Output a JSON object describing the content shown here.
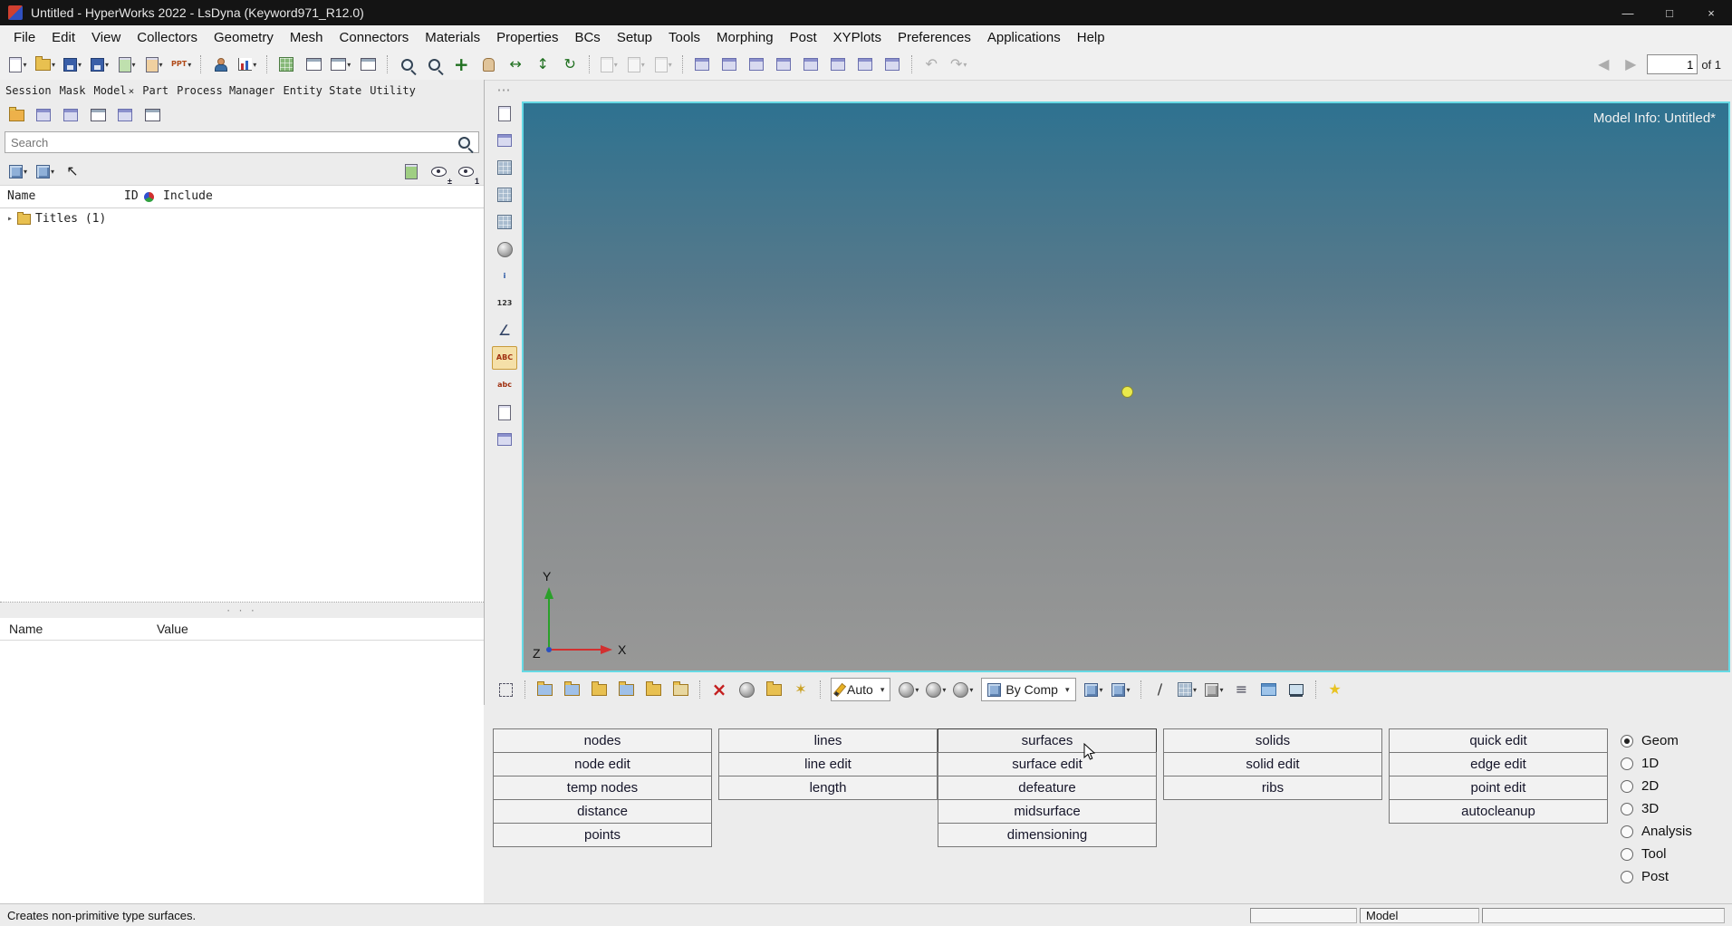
{
  "ui": {
    "close_glyph": "×",
    "dropdown_glyph": "▾"
  },
  "titlebar": {
    "title": "Untitled - HyperWorks 2022 - LsDyna (Keyword971_R12.0)",
    "controls": [
      {
        "name": "minimize-button",
        "glyph": "—"
      },
      {
        "name": "maximize-button",
        "glyph": "□"
      },
      {
        "name": "close-button",
        "glyph": "×"
      }
    ]
  },
  "menubar": {
    "items": [
      "File",
      "Edit",
      "View",
      "Collectors",
      "Geometry",
      "Mesh",
      "Connectors",
      "Materials",
      "Properties",
      "BCs",
      "Setup",
      "Tools",
      "Morphing",
      "Post",
      "XYPlots",
      "Preferences",
      "Applications",
      "Help"
    ]
  },
  "toolbar_top": {
    "icons": [
      {
        "name": "new-session-icon",
        "kind": "doc",
        "dd": true
      },
      {
        "name": "open-file-icon",
        "kind": "folder",
        "dd": true
      },
      {
        "name": "save-file-icon",
        "kind": "disk",
        "dd": true
      },
      {
        "name": "save-as-icon",
        "kind": "disk",
        "dd": true
      },
      {
        "name": "import-icon",
        "kind": "doc",
        "tint": "#bfe0ae",
        "dd": true
      },
      {
        "name": "export-icon",
        "kind": "doc",
        "tint": "#f0d0a0",
        "dd": true
      },
      {
        "name": "publish-ppt-icon",
        "kind": "text",
        "text": "PPT",
        "dd": true
      },
      {
        "kind": "sep"
      },
      {
        "name": "user-profiles-icon",
        "kind": "user"
      },
      {
        "name": "plot-report-icon",
        "kind": "chart",
        "dd": true
      },
      {
        "kind": "sep"
      },
      {
        "name": "screen-capture-grid-icon",
        "kind": "grid"
      },
      {
        "name": "empty-page-icon",
        "kind": "win"
      },
      {
        "name": "page-layout-icon",
        "kind": "win",
        "dd": true
      },
      {
        "name": "split-window-icon",
        "kind": "win"
      },
      {
        "kind": "sep"
      },
      {
        "name": "zoom-icon",
        "kind": "mag"
      },
      {
        "name": "fit-view-icon",
        "kind": "mag"
      },
      {
        "name": "center-view-icon",
        "glyph": "+",
        "color": "#207020",
        "big": true
      },
      {
        "name": "pan-hand-icon",
        "kind": "hand"
      },
      {
        "name": "dynamic-rotate-icon",
        "glyph": "↔",
        "color": "#207020"
      },
      {
        "name": "dynamic-zoom-icon",
        "glyph": "↕",
        "color": "#207020"
      },
      {
        "name": "refresh-view-icon",
        "glyph": "↻",
        "color": "#207020"
      },
      {
        "kind": "sep"
      },
      {
        "name": "cut-icon",
        "kind": "doc",
        "disabled": true,
        "dd": true
      },
      {
        "name": "copy-icon",
        "kind": "doc",
        "disabled": true,
        "dd": true
      },
      {
        "name": "paste-icon",
        "kind": "doc",
        "disabled": true,
        "dd": true
      },
      {
        "kind": "sep"
      },
      {
        "name": "add-page-icon",
        "kind": "winp"
      },
      {
        "name": "delete-page-icon",
        "kind": "winp"
      },
      {
        "name": "next-window-icon",
        "kind": "winp"
      },
      {
        "name": "expand-window-icon",
        "kind": "winp"
      },
      {
        "name": "tile-vertical-icon",
        "kind": "winp"
      },
      {
        "name": "tile-horizontal-icon",
        "kind": "winp"
      },
      {
        "name": "swap-window-icon",
        "kind": "winp"
      },
      {
        "name": "record-window-icon",
        "kind": "winp"
      },
      {
        "kind": "sep"
      },
      {
        "name": "undo-icon",
        "glyph": "↶",
        "disabled": true
      },
      {
        "name": "redo-icon",
        "glyph": "↷",
        "disabled": true,
        "dd": true
      }
    ],
    "nav_icons": [
      {
        "name": "previous-page-icon",
        "glyph": "◀",
        "disabled": true
      },
      {
        "name": "next-page-icon",
        "glyph": "▶",
        "disabled": true
      }
    ],
    "page_value": "1",
    "page_suffix": "of 1"
  },
  "left_panel": {
    "tabs": [
      {
        "label": "Session"
      },
      {
        "label": "Mask"
      },
      {
        "label": "Model",
        "active": true,
        "closable": true
      },
      {
        "label": "Part"
      },
      {
        "label": "Process Manager"
      },
      {
        "label": "Entity State"
      },
      {
        "label": "Utility"
      }
    ],
    "browser_toolbar": [
      {
        "name": "entities-view-icon",
        "kind": "folder",
        "tint": "#edb14a"
      },
      {
        "name": "create-subsystem-icon",
        "kind": "winp"
      },
      {
        "name": "organize-entities-icon",
        "kind": "winp"
      },
      {
        "name": "configure-browser-icon",
        "kind": "win"
      },
      {
        "name": "filter-entities-icon",
        "kind": "winp"
      },
      {
        "name": "refresh-browser-icon",
        "kind": "win"
      }
    ],
    "search_placeholder": "Search",
    "display_left": [
      {
        "name": "show-entities-dropdown-icon",
        "kind": "cube",
        "dd": true
      },
      {
        "name": "display-mode-dropdown-icon",
        "kind": "cube",
        "dd": true
      },
      {
        "name": "selector-arrow-icon",
        "glyph": "↖",
        "color": "#222222"
      }
    ],
    "display_right": [
      {
        "name": "add-to-collector-icon",
        "kind": "doc",
        "tint": "#9fce83"
      },
      {
        "name": "show-hide-toggle-icon",
        "kind": "eye",
        "sub": "±"
      },
      {
        "name": "isolate-one-icon",
        "kind": "eye",
        "sub": "1"
      }
    ],
    "columns": {
      "name": "Name",
      "id": "ID",
      "include": "Include"
    },
    "tree": [
      {
        "label": "Titles (1)"
      }
    ],
    "props_columns": {
      "name": "Name",
      "value": "Value"
    }
  },
  "side_toolbar": {
    "icons": [
      {
        "name": "clipboard-icon",
        "kind": "doc"
      },
      {
        "name": "mask-panel-icon",
        "kind": "winp"
      },
      {
        "name": "model-checker-icon",
        "kind": "grid2"
      },
      {
        "name": "matrix-panel-icon",
        "kind": "grid2"
      },
      {
        "name": "spreadsheet-icon",
        "kind": "grid2"
      },
      {
        "name": "contour-sphere-icon",
        "kind": "sphere"
      },
      {
        "name": "entity-info-icon",
        "kind": "text",
        "text": "i",
        "color": "#2050a0"
      },
      {
        "name": "numbering-icon",
        "kind": "text",
        "text": "123",
        "color": "#333333"
      },
      {
        "name": "measure-angle-icon",
        "glyph": "∠",
        "color": "#334466"
      },
      {
        "name": "titles-text-icon",
        "kind": "text",
        "text": "ABC",
        "color": "#a03010",
        "pressed": true
      },
      {
        "name": "tags-icon",
        "kind": "text",
        "text": "abc",
        "color": "#a03010"
      },
      {
        "name": "section-cut-icon",
        "kind": "doc"
      },
      {
        "name": "screen-display-icon",
        "kind": "winp"
      }
    ]
  },
  "viewport": {
    "model_info": "Model Info: Untitled*",
    "axis": {
      "x": "X",
      "y": "Y",
      "z": "Z"
    }
  },
  "toolbar_bottom": {
    "group1": [
      {
        "name": "selection-box-icon",
        "kind": "dash"
      },
      {
        "kind": "sep"
      },
      {
        "name": "open-model-icon",
        "kind": "folder",
        "tint": "#9fc0e8"
      },
      {
        "name": "save-model-icon",
        "kind": "folder",
        "tint": "#9fc0e8"
      },
      {
        "name": "organize-collectors-icon",
        "kind": "folder"
      },
      {
        "name": "import-solver-deck-icon",
        "kind": "folder",
        "tint": "#9fc0e8"
      },
      {
        "name": "export-solver-deck-icon",
        "kind": "folder"
      },
      {
        "name": "session-folder-icon",
        "kind": "folder",
        "tint": "#e8d79f"
      },
      {
        "kind": "sep"
      },
      {
        "name": "delete-entities-icon",
        "glyph": "×",
        "color": "#c41e1e",
        "big": true
      },
      {
        "name": "primitives-sphere-icon",
        "kind": "sphere"
      },
      {
        "name": "open-session-icon",
        "kind": "folder"
      },
      {
        "name": "quick-wand-icon",
        "glyph": "✶",
        "color": "#caa020"
      },
      {
        "kind": "sep"
      }
    ],
    "auto_dropdown": {
      "label": "Auto"
    },
    "group2": [
      {
        "name": "shaded-geometry-icon",
        "kind": "sphere",
        "dd": true
      },
      {
        "name": "shaded-elements-icon",
        "kind": "sphere",
        "dd": true
      },
      {
        "name": "element-representation-icon",
        "kind": "sphere",
        "dd": true
      }
    ],
    "bycomp_dropdown": {
      "label": "By Comp"
    },
    "group3": [
      {
        "name": "mesh-shade-icon",
        "kind": "cube",
        "dd": true
      },
      {
        "name": "geometry-shade-icon",
        "kind": "cube",
        "dd": true
      },
      {
        "kind": "sep"
      },
      {
        "name": "wireframe-icon",
        "glyph": "∕",
        "color": "#333333"
      },
      {
        "name": "feature-angle-icon",
        "kind": "grid2",
        "dd": true
      },
      {
        "name": "shaded-solid-icon",
        "kind": "cubeShade",
        "dd": true
      },
      {
        "name": "layer-stack-icon",
        "glyph": "≡",
        "color": "#444455"
      },
      {
        "name": "dual-view-icon",
        "kind": "winblue"
      },
      {
        "name": "performance-monitor-icon",
        "kind": "monitor"
      },
      {
        "kind": "sep"
      },
      {
        "name": "favorites-star-icon",
        "glyph": "★",
        "color": "#e8c323"
      }
    ]
  },
  "panel": {
    "columns": [
      [
        "nodes",
        "node edit",
        "temp nodes",
        "distance",
        "points"
      ],
      [
        "lines",
        "line edit",
        "length"
      ],
      [
        "surfaces",
        "surface edit",
        "defeature",
        "midsurface",
        "dimensioning"
      ],
      [
        "solids",
        "solid edit",
        "ribs"
      ],
      [
        "quick edit",
        "edge edit",
        "point edit",
        "autocleanup"
      ]
    ],
    "hovered": "surfaces",
    "modes": [
      {
        "label": "Geom",
        "selected": true
      },
      {
        "label": "1D"
      },
      {
        "label": "2D"
      },
      {
        "label": "3D"
      },
      {
        "label": "Analysis"
      },
      {
        "label": "Tool"
      },
      {
        "label": "Post"
      }
    ]
  },
  "statusbar": {
    "message": "Creates non-primitive type surfaces.",
    "cells": [
      "",
      "Model",
      ""
    ]
  }
}
